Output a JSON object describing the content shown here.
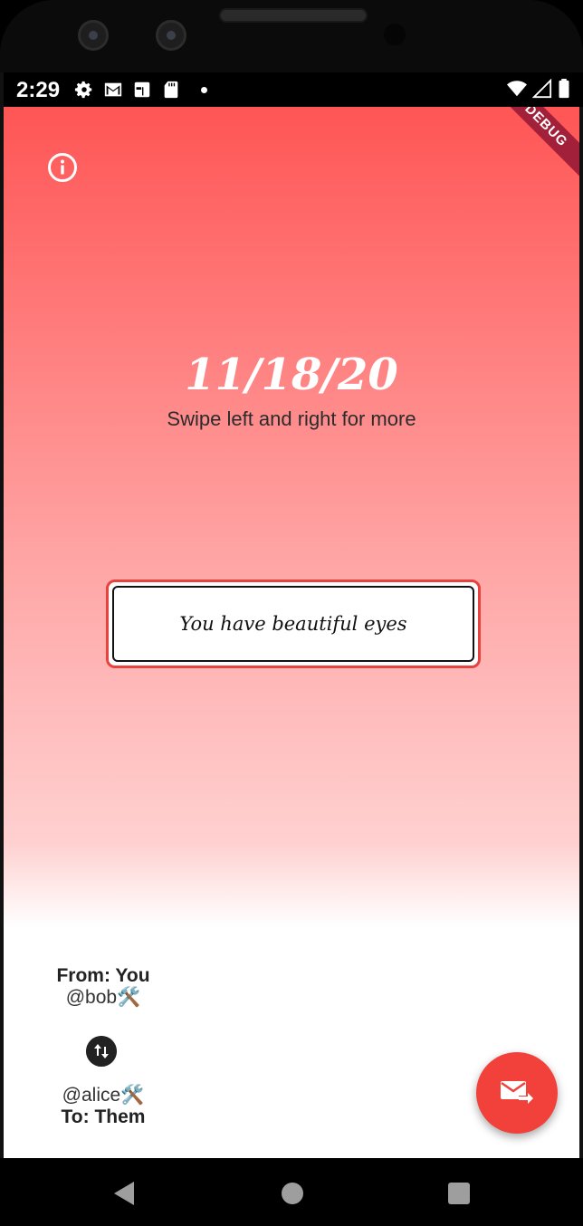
{
  "status_bar": {
    "time": "2:29",
    "icons": [
      "gear-icon",
      "gmail-icon",
      "calendar-icon",
      "sd-card-icon",
      "notification-dot",
      "wifi-icon",
      "signal-icon",
      "battery-icon"
    ]
  },
  "debug_banner": "DEBUG",
  "screen": {
    "date": "11/18/20",
    "subtitle": "Swipe left and right for more",
    "compliment": "You have beautiful eyes"
  },
  "sender": {
    "label": "From: You",
    "handle": "@bob🛠️"
  },
  "recipient": {
    "handle": "@alice🛠️",
    "label": "To: Them"
  },
  "colors": {
    "gradient_top": "#ff5555",
    "card_border": "#e9413d",
    "fab": "#f2413b"
  }
}
